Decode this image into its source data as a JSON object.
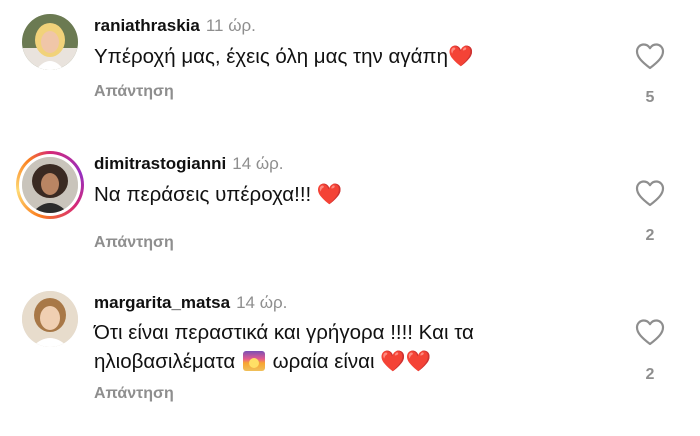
{
  "comments": [
    {
      "username": "raniathraskia",
      "time": "11 ώρ.",
      "text": "Υπέροχή μας, έχεις όλη μας την αγάπη",
      "emoji_suffix": "❤️",
      "reply_label": "Απάντηση",
      "likes": "5",
      "has_story": false
    },
    {
      "username": "dimitrastogianni",
      "time": "14 ώρ.",
      "text": "Να περάσεις υπέροχα!!! ",
      "emoji_suffix": "❤️",
      "reply_label": "Απάντηση",
      "likes": "2",
      "has_story": true
    },
    {
      "username": "margarita_matsa",
      "time": "14 ώρ.",
      "text_line1": "Ότι είναι περαστικά και γρήγορα !!!! Και τα",
      "text_line2_a": "ηλιοβασιλέματα",
      "text_line2_b": "ωραία είναι",
      "emoji_hearts": "❤️❤️",
      "reply_label": "Απάντηση",
      "likes": "2",
      "has_story": false
    }
  ],
  "icons": {
    "like": "heart-outline-icon",
    "sunset": "sunset-emoji"
  },
  "colors": {
    "text": "#111111",
    "muted": "#8e8e8e",
    "heart": "#e0141e"
  }
}
